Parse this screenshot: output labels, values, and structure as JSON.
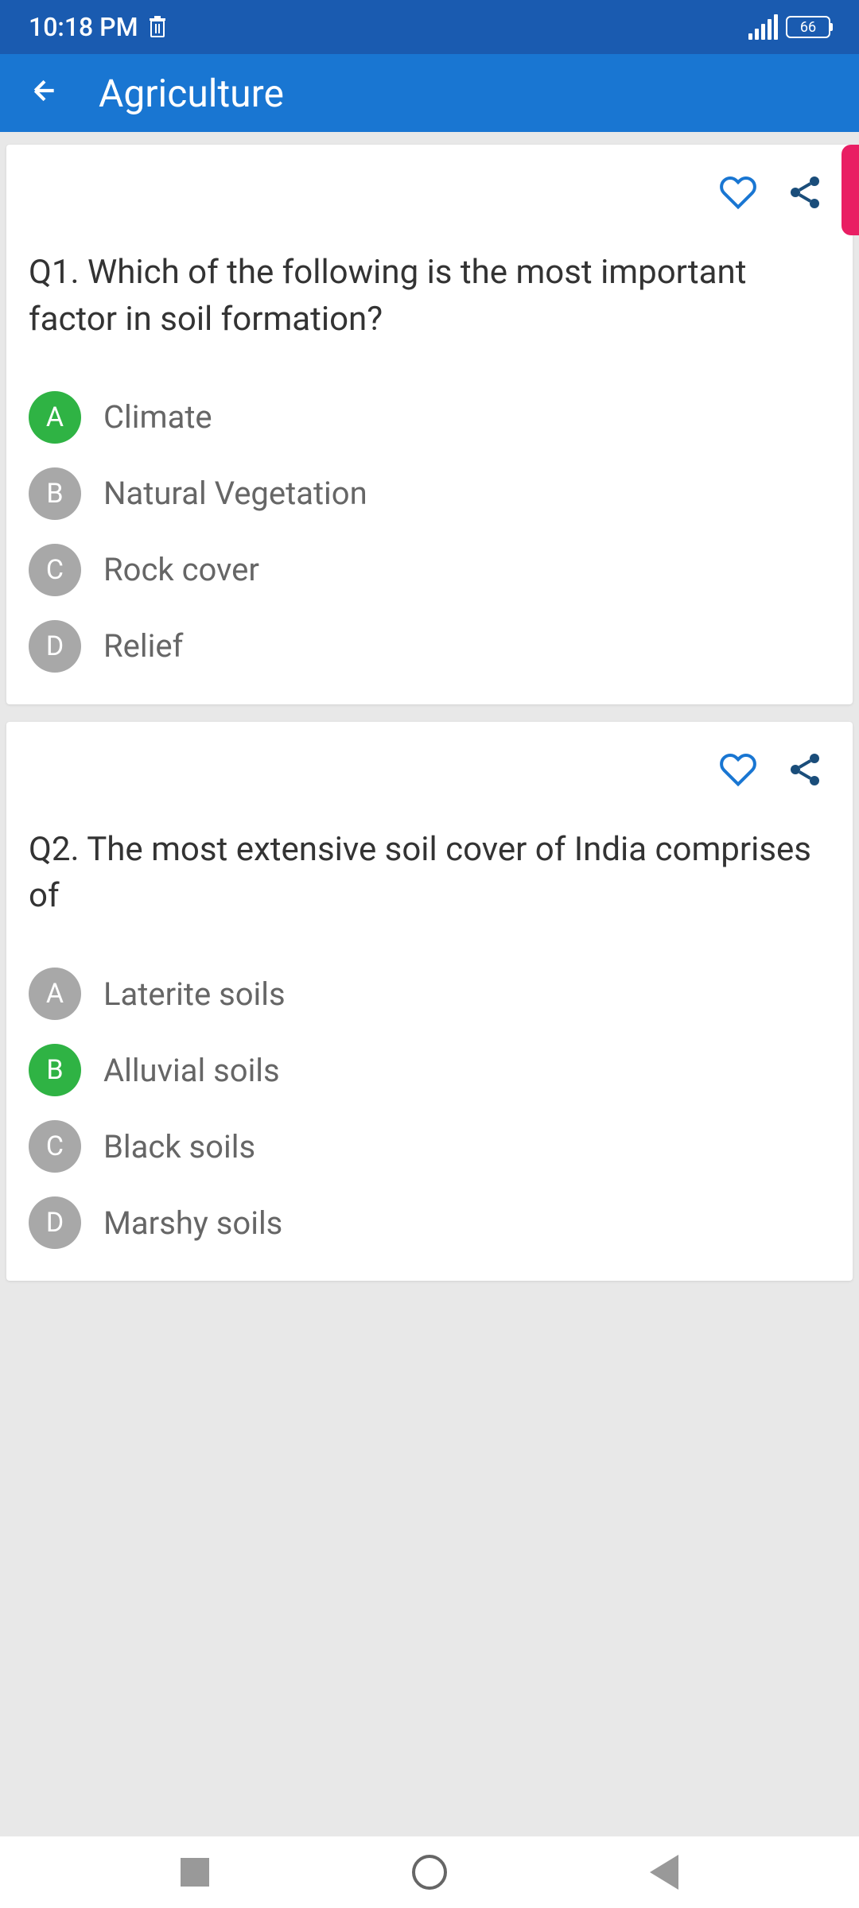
{
  "status": {
    "time": "10:18 PM",
    "battery": "66"
  },
  "header": {
    "title": "Agriculture"
  },
  "questions": [
    {
      "prefix": "Q1.",
      "text": "Which of the following is the most important factor in soil formation?",
      "options": [
        {
          "letter": "A",
          "text": "Climate",
          "correct": true
        },
        {
          "letter": "B",
          "text": "Natural Vegetation",
          "correct": false
        },
        {
          "letter": "C",
          "text": "Rock cover",
          "correct": false
        },
        {
          "letter": "D",
          "text": "Relief",
          "correct": false
        }
      ]
    },
    {
      "prefix": "Q2.",
      "text": "The most extensive soil cover of India comprises of",
      "options": [
        {
          "letter": "A",
          "text": "Laterite soils",
          "correct": false
        },
        {
          "letter": "B",
          "text": "Alluvial soils",
          "correct": true
        },
        {
          "letter": "C",
          "text": "Black soils",
          "correct": false
        },
        {
          "letter": "D",
          "text": "Marshy soils",
          "correct": false
        }
      ]
    }
  ]
}
